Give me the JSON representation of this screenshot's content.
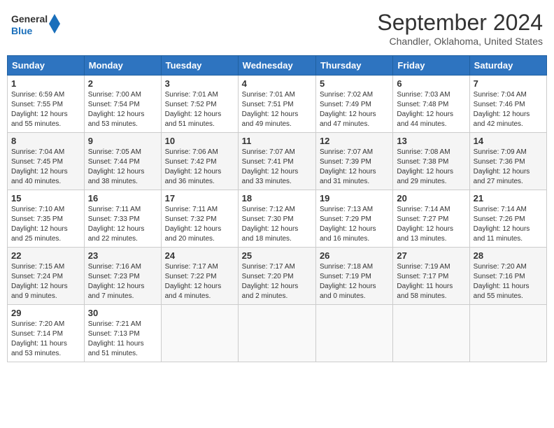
{
  "header": {
    "logo_line1": "General",
    "logo_line2": "Blue",
    "main_title": "September 2024",
    "subtitle": "Chandler, Oklahoma, United States"
  },
  "columns": [
    "Sunday",
    "Monday",
    "Tuesday",
    "Wednesday",
    "Thursday",
    "Friday",
    "Saturday"
  ],
  "weeks": [
    [
      {
        "day": "1",
        "info": "Sunrise: 6:59 AM\nSunset: 7:55 PM\nDaylight: 12 hours\nand 55 minutes."
      },
      {
        "day": "2",
        "info": "Sunrise: 7:00 AM\nSunset: 7:54 PM\nDaylight: 12 hours\nand 53 minutes."
      },
      {
        "day": "3",
        "info": "Sunrise: 7:01 AM\nSunset: 7:52 PM\nDaylight: 12 hours\nand 51 minutes."
      },
      {
        "day": "4",
        "info": "Sunrise: 7:01 AM\nSunset: 7:51 PM\nDaylight: 12 hours\nand 49 minutes."
      },
      {
        "day": "5",
        "info": "Sunrise: 7:02 AM\nSunset: 7:49 PM\nDaylight: 12 hours\nand 47 minutes."
      },
      {
        "day": "6",
        "info": "Sunrise: 7:03 AM\nSunset: 7:48 PM\nDaylight: 12 hours\nand 44 minutes."
      },
      {
        "day": "7",
        "info": "Sunrise: 7:04 AM\nSunset: 7:46 PM\nDaylight: 12 hours\nand 42 minutes."
      }
    ],
    [
      {
        "day": "8",
        "info": "Sunrise: 7:04 AM\nSunset: 7:45 PM\nDaylight: 12 hours\nand 40 minutes."
      },
      {
        "day": "9",
        "info": "Sunrise: 7:05 AM\nSunset: 7:44 PM\nDaylight: 12 hours\nand 38 minutes."
      },
      {
        "day": "10",
        "info": "Sunrise: 7:06 AM\nSunset: 7:42 PM\nDaylight: 12 hours\nand 36 minutes."
      },
      {
        "day": "11",
        "info": "Sunrise: 7:07 AM\nSunset: 7:41 PM\nDaylight: 12 hours\nand 33 minutes."
      },
      {
        "day": "12",
        "info": "Sunrise: 7:07 AM\nSunset: 7:39 PM\nDaylight: 12 hours\nand 31 minutes."
      },
      {
        "day": "13",
        "info": "Sunrise: 7:08 AM\nSunset: 7:38 PM\nDaylight: 12 hours\nand 29 minutes."
      },
      {
        "day": "14",
        "info": "Sunrise: 7:09 AM\nSunset: 7:36 PM\nDaylight: 12 hours\nand 27 minutes."
      }
    ],
    [
      {
        "day": "15",
        "info": "Sunrise: 7:10 AM\nSunset: 7:35 PM\nDaylight: 12 hours\nand 25 minutes."
      },
      {
        "day": "16",
        "info": "Sunrise: 7:11 AM\nSunset: 7:33 PM\nDaylight: 12 hours\nand 22 minutes."
      },
      {
        "day": "17",
        "info": "Sunrise: 7:11 AM\nSunset: 7:32 PM\nDaylight: 12 hours\nand 20 minutes."
      },
      {
        "day": "18",
        "info": "Sunrise: 7:12 AM\nSunset: 7:30 PM\nDaylight: 12 hours\nand 18 minutes."
      },
      {
        "day": "19",
        "info": "Sunrise: 7:13 AM\nSunset: 7:29 PM\nDaylight: 12 hours\nand 16 minutes."
      },
      {
        "day": "20",
        "info": "Sunrise: 7:14 AM\nSunset: 7:27 PM\nDaylight: 12 hours\nand 13 minutes."
      },
      {
        "day": "21",
        "info": "Sunrise: 7:14 AM\nSunset: 7:26 PM\nDaylight: 12 hours\nand 11 minutes."
      }
    ],
    [
      {
        "day": "22",
        "info": "Sunrise: 7:15 AM\nSunset: 7:24 PM\nDaylight: 12 hours\nand 9 minutes."
      },
      {
        "day": "23",
        "info": "Sunrise: 7:16 AM\nSunset: 7:23 PM\nDaylight: 12 hours\nand 7 minutes."
      },
      {
        "day": "24",
        "info": "Sunrise: 7:17 AM\nSunset: 7:22 PM\nDaylight: 12 hours\nand 4 minutes."
      },
      {
        "day": "25",
        "info": "Sunrise: 7:17 AM\nSunset: 7:20 PM\nDaylight: 12 hours\nand 2 minutes."
      },
      {
        "day": "26",
        "info": "Sunrise: 7:18 AM\nSunset: 7:19 PM\nDaylight: 12 hours\nand 0 minutes."
      },
      {
        "day": "27",
        "info": "Sunrise: 7:19 AM\nSunset: 7:17 PM\nDaylight: 11 hours\nand 58 minutes."
      },
      {
        "day": "28",
        "info": "Sunrise: 7:20 AM\nSunset: 7:16 PM\nDaylight: 11 hours\nand 55 minutes."
      }
    ],
    [
      {
        "day": "29",
        "info": "Sunrise: 7:20 AM\nSunset: 7:14 PM\nDaylight: 11 hours\nand 53 minutes."
      },
      {
        "day": "30",
        "info": "Sunrise: 7:21 AM\nSunset: 7:13 PM\nDaylight: 11 hours\nand 51 minutes."
      },
      null,
      null,
      null,
      null,
      null
    ]
  ]
}
